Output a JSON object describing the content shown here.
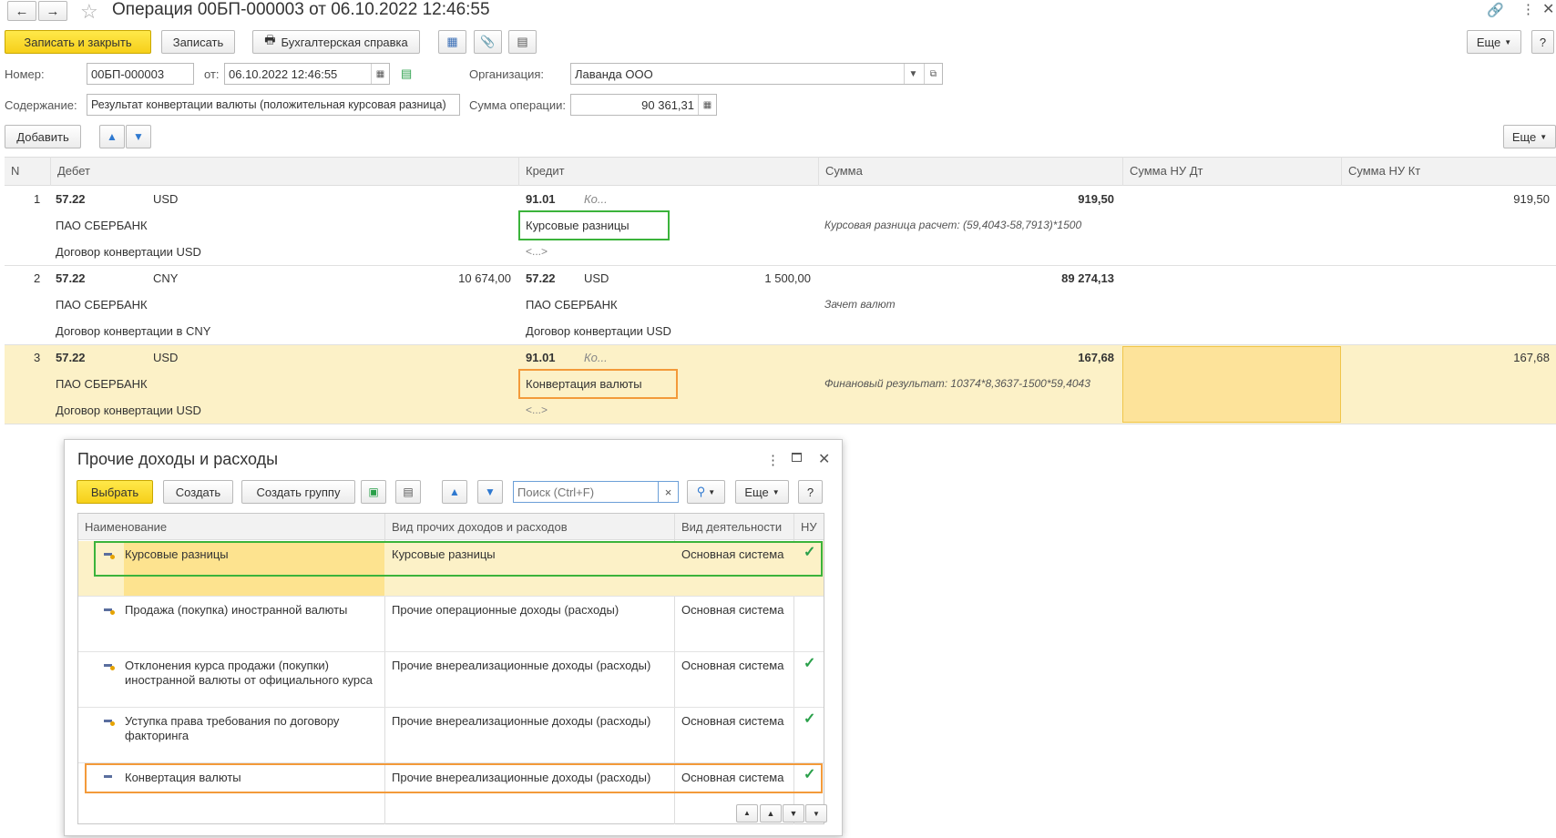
{
  "window": {
    "title": "Операция 00БП-000003 от 06.10.2022 12:46:55"
  },
  "toolbar": {
    "save_close": "Записать и закрыть",
    "save": "Записать",
    "accounting_note": "Бухгалтерская справка",
    "more": "Еще",
    "help": "?"
  },
  "form": {
    "number_label": "Номер:",
    "number_value": "00БП-000003",
    "date_label": "от:",
    "date_value": "06.10.2022 12:46:55",
    "org_label": "Организация:",
    "org_value": "Лаванда ООО",
    "content_label": "Содержание:",
    "content_value": "Результат конвертации валюты (положительная курсовая разница)",
    "sum_label": "Сумма операции:",
    "sum_value": "90 361,31"
  },
  "table_toolbar": {
    "add": "Добавить",
    "more": "Еще"
  },
  "table": {
    "headers": [
      "N",
      "Дебет",
      "Кредит",
      "Сумма",
      "Сумма НУ Дт",
      "Сумма НУ Кт"
    ],
    "rows": [
      {
        "n": "1",
        "debit_account": "57.22",
        "debit_currency": "USD",
        "debit_amount": "",
        "debit_sub1": "ПАО СБЕРБАНК",
        "debit_sub2": "Договор конвертации USD",
        "credit_account": "91.01",
        "credit_currency": "Ко...",
        "credit_amount": "",
        "credit_sub1": "Курсовые разницы",
        "credit_sub2": "<...>",
        "sum": "919,50",
        "sum_note": "Курсовая разница расчет: (59,4043-58,7913)*1500",
        "nu_dt": "",
        "nu_kt": "919,50"
      },
      {
        "n": "2",
        "debit_account": "57.22",
        "debit_currency": "CNY",
        "debit_amount": "10 674,00",
        "debit_sub1": "ПАО СБЕРБАНК",
        "debit_sub2": "Договор конвертации в CNY",
        "credit_account": "57.22",
        "credit_currency": "USD",
        "credit_amount": "1 500,00",
        "credit_sub1": "ПАО СБЕРБАНК",
        "credit_sub2": "Договор конвертации USD",
        "sum": "89 274,13",
        "sum_note": "Зачет валют",
        "nu_dt": "",
        "nu_kt": ""
      },
      {
        "n": "3",
        "debit_account": "57.22",
        "debit_currency": "USD",
        "debit_amount": "",
        "debit_sub1": "ПАО СБЕРБАНК",
        "debit_sub2": "Договор конвертации USD",
        "credit_account": "91.01",
        "credit_currency": "Ко...",
        "credit_amount": "",
        "credit_sub1": "Конвертация валюты",
        "credit_sub2": "<...>",
        "sum": "167,68",
        "sum_note": "Финановый результат: 10374*8,3637-1500*59,4043",
        "nu_dt": "",
        "nu_kt": "167,68"
      }
    ]
  },
  "popup": {
    "title": "Прочие доходы и расходы",
    "select": "Выбрать",
    "create": "Создать",
    "create_group": "Создать группу",
    "search_placeholder": "Поиск (Ctrl+F)",
    "search_clear": "×",
    "more": "Еще",
    "help": "?",
    "headers": [
      "Наименование",
      "Вид прочих доходов и расходов",
      "Вид деятельности",
      "НУ"
    ],
    "rows": [
      {
        "name": "Курсовые разницы",
        "kind": "Курсовые разницы",
        "activity": "Основная система",
        "nu": "✓"
      },
      {
        "name": "Продажа (покупка) иностранной валюты",
        "kind": "Прочие операционные доходы (расходы)",
        "activity": "Основная система",
        "nu": ""
      },
      {
        "name": "Отклонения курса продажи (покупки) иностранной валюты от официального курса",
        "kind": "Прочие внереализационные доходы (расходы)",
        "activity": "Основная система",
        "nu": "✓"
      },
      {
        "name": "Уступка права требования по договору факторинга",
        "kind": "Прочие внереализационные доходы (расходы)",
        "activity": "Основная система",
        "nu": "✓"
      },
      {
        "name": "Конвертация валюты",
        "kind": "Прочие внереализационные доходы (расходы)",
        "activity": "Основная система",
        "nu": "✓"
      }
    ]
  }
}
